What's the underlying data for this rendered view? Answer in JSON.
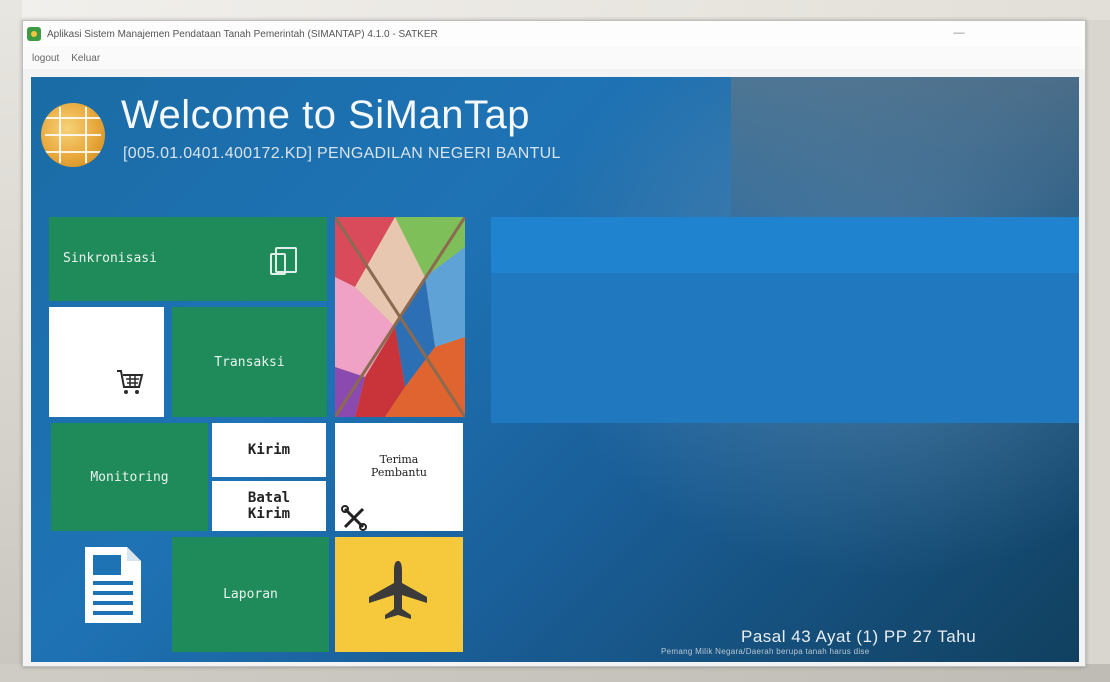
{
  "window": {
    "title": "Aplikasi Sistem Manajemen Pendataan Tanah Pemerintah (SIMANTAP) 4.1.0 - SATKER",
    "minimize": "—"
  },
  "menu": {
    "logout": "logout",
    "keluar": "Keluar"
  },
  "header": {
    "welcome": "Welcome to SiManTap",
    "subtitle": "[005.01.0401.400172.KD] PENGADILAN NEGERI BANTUL"
  },
  "tiles": {
    "sinkronisasi": "Sinkronisasi",
    "transaksi": "Transaksi",
    "monitoring": "Monitoring",
    "kirim": "Kirim",
    "batal_kirim": "Batal\nKirim",
    "terima_pembantu": "Terima\nPembantu",
    "laporan": "Laporan"
  },
  "footer": {
    "quote": "Pasal 43 Ayat (1) PP 27 Tahu",
    "sub": "Pemang   Milik   Negara/Daerah   berupa   tanah   harus dise"
  },
  "colors": {
    "tile_green": "#1f8a5a",
    "tile_yellow": "#f5c93b",
    "app_blue": "#1e73b5"
  },
  "icons": [
    "app-icon",
    "globe-logo-icon",
    "documents-icon",
    "shopping-cart-icon",
    "tools-icon",
    "document-icon",
    "airplane-icon"
  ]
}
